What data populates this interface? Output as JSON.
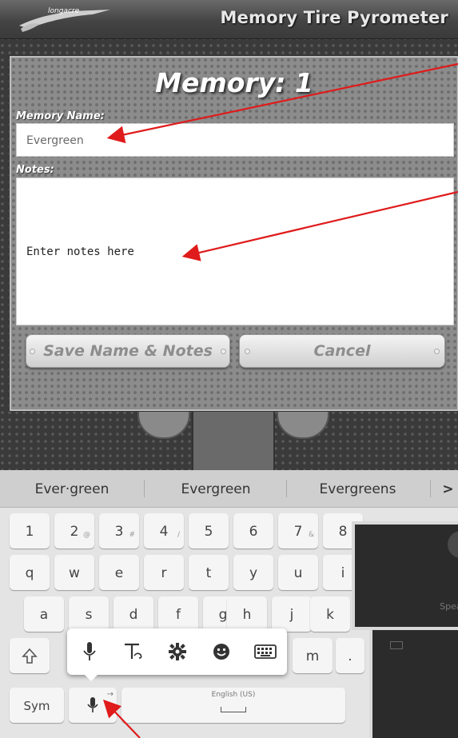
{
  "header": {
    "title": "Memory Tire Pyrometer",
    "logo_text": "longacre"
  },
  "dialog": {
    "title": "Memory: 1",
    "name_label": "Memory Name:",
    "name_value": "Evergreen",
    "notes_label": "Notes:",
    "notes_placeholder": "Enter notes here",
    "save_label": "Save Name & Notes",
    "cancel_label": "Cancel"
  },
  "keyboard": {
    "suggestions": [
      "Ever·green",
      "Evergreen",
      "Evergreens"
    ],
    "suggestions_more": ">",
    "number_row": [
      "1",
      "2",
      "3",
      "4",
      "5",
      "6",
      "7",
      "8"
    ],
    "number_hints": [
      "",
      "@",
      "#",
      "/",
      "",
      "",
      "&",
      ""
    ],
    "row_q": [
      "q",
      "w",
      "e",
      "r",
      "t",
      "y",
      "u",
      "i"
    ],
    "row_a": [
      "a",
      "s",
      "d",
      "f",
      "g",
      "h",
      "j",
      "k"
    ],
    "row_z": [
      "m",
      "."
    ],
    "sym_label": "Sym",
    "space_label": "English (US)",
    "popup_icons": [
      "microphone-icon",
      "text-recognition-icon",
      "settings-gear-icon",
      "emoji-icon",
      "keyboard-icon"
    ]
  },
  "overlays": {
    "speak_label": "Speak",
    "tap_label": "Ta"
  },
  "colors": {
    "arrow": "#e01b1b",
    "dialog_bg": "#8c8c8c",
    "header_text": "#e8e8e8"
  }
}
